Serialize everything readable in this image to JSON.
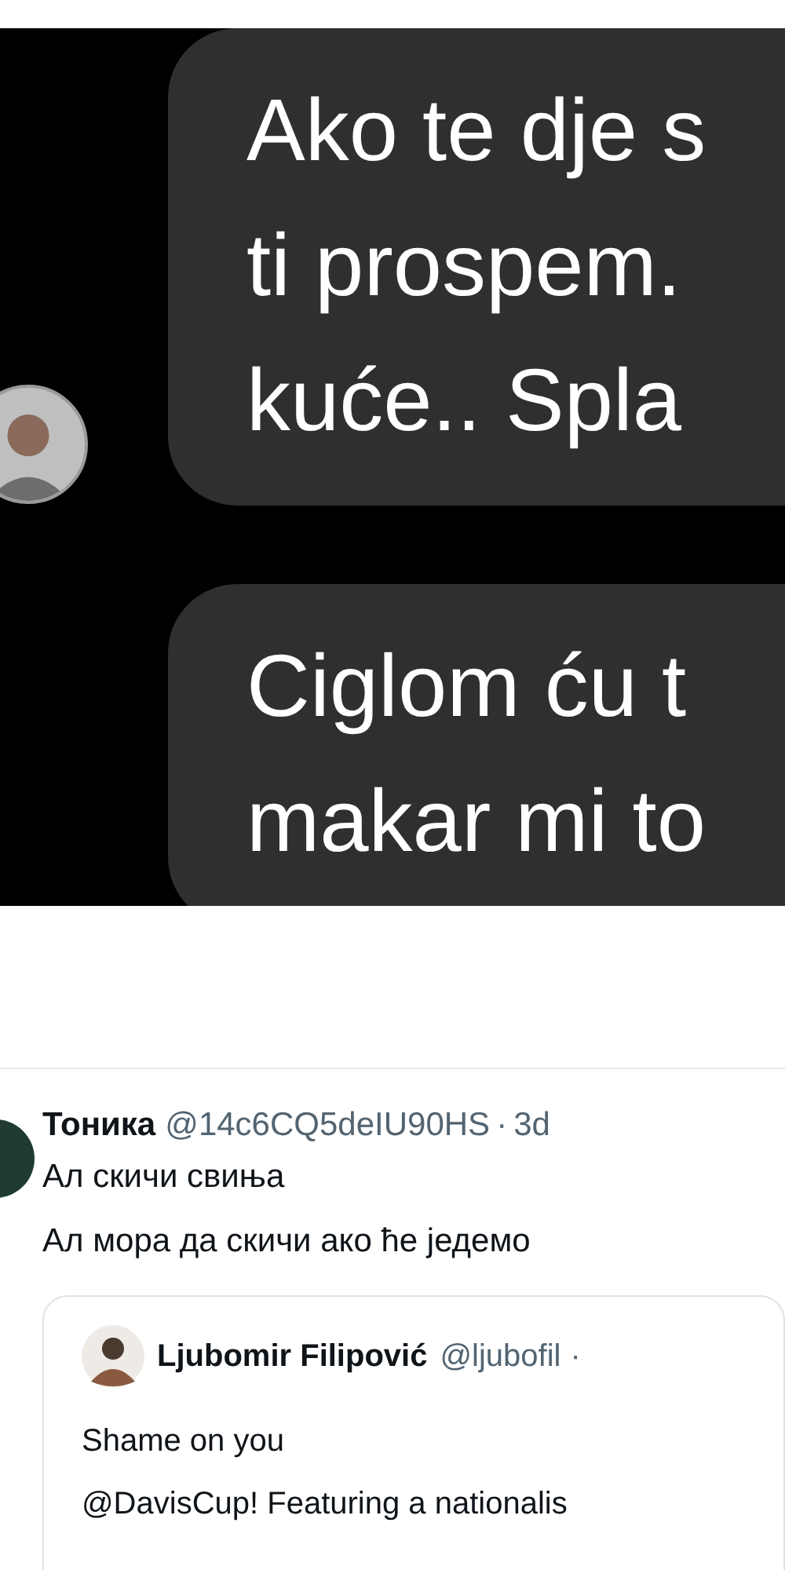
{
  "chat": {
    "messages": [
      {
        "lines": [
          "Ako te dje s",
          "ti prospem.",
          "kuće.. Spla"
        ],
        "avatar": true
      },
      {
        "lines": [
          "Ciglom ću t",
          "makar mi to"
        ],
        "avatar": false
      }
    ]
  },
  "tweet": {
    "name": "Тоника",
    "handle": "@14c6CQ5deIU90HS",
    "separator": "·",
    "time": "3d",
    "lines": [
      "Ал скичи свиња",
      "Ал мора да скичи ако ће једемо"
    ],
    "quote": {
      "name": "Ljubomir Filipović",
      "handle": "@ljubofil",
      "separator": "·",
      "lines": [
        "Shame on you",
        "@DavisCup! Featuring a nationalis"
      ]
    }
  }
}
